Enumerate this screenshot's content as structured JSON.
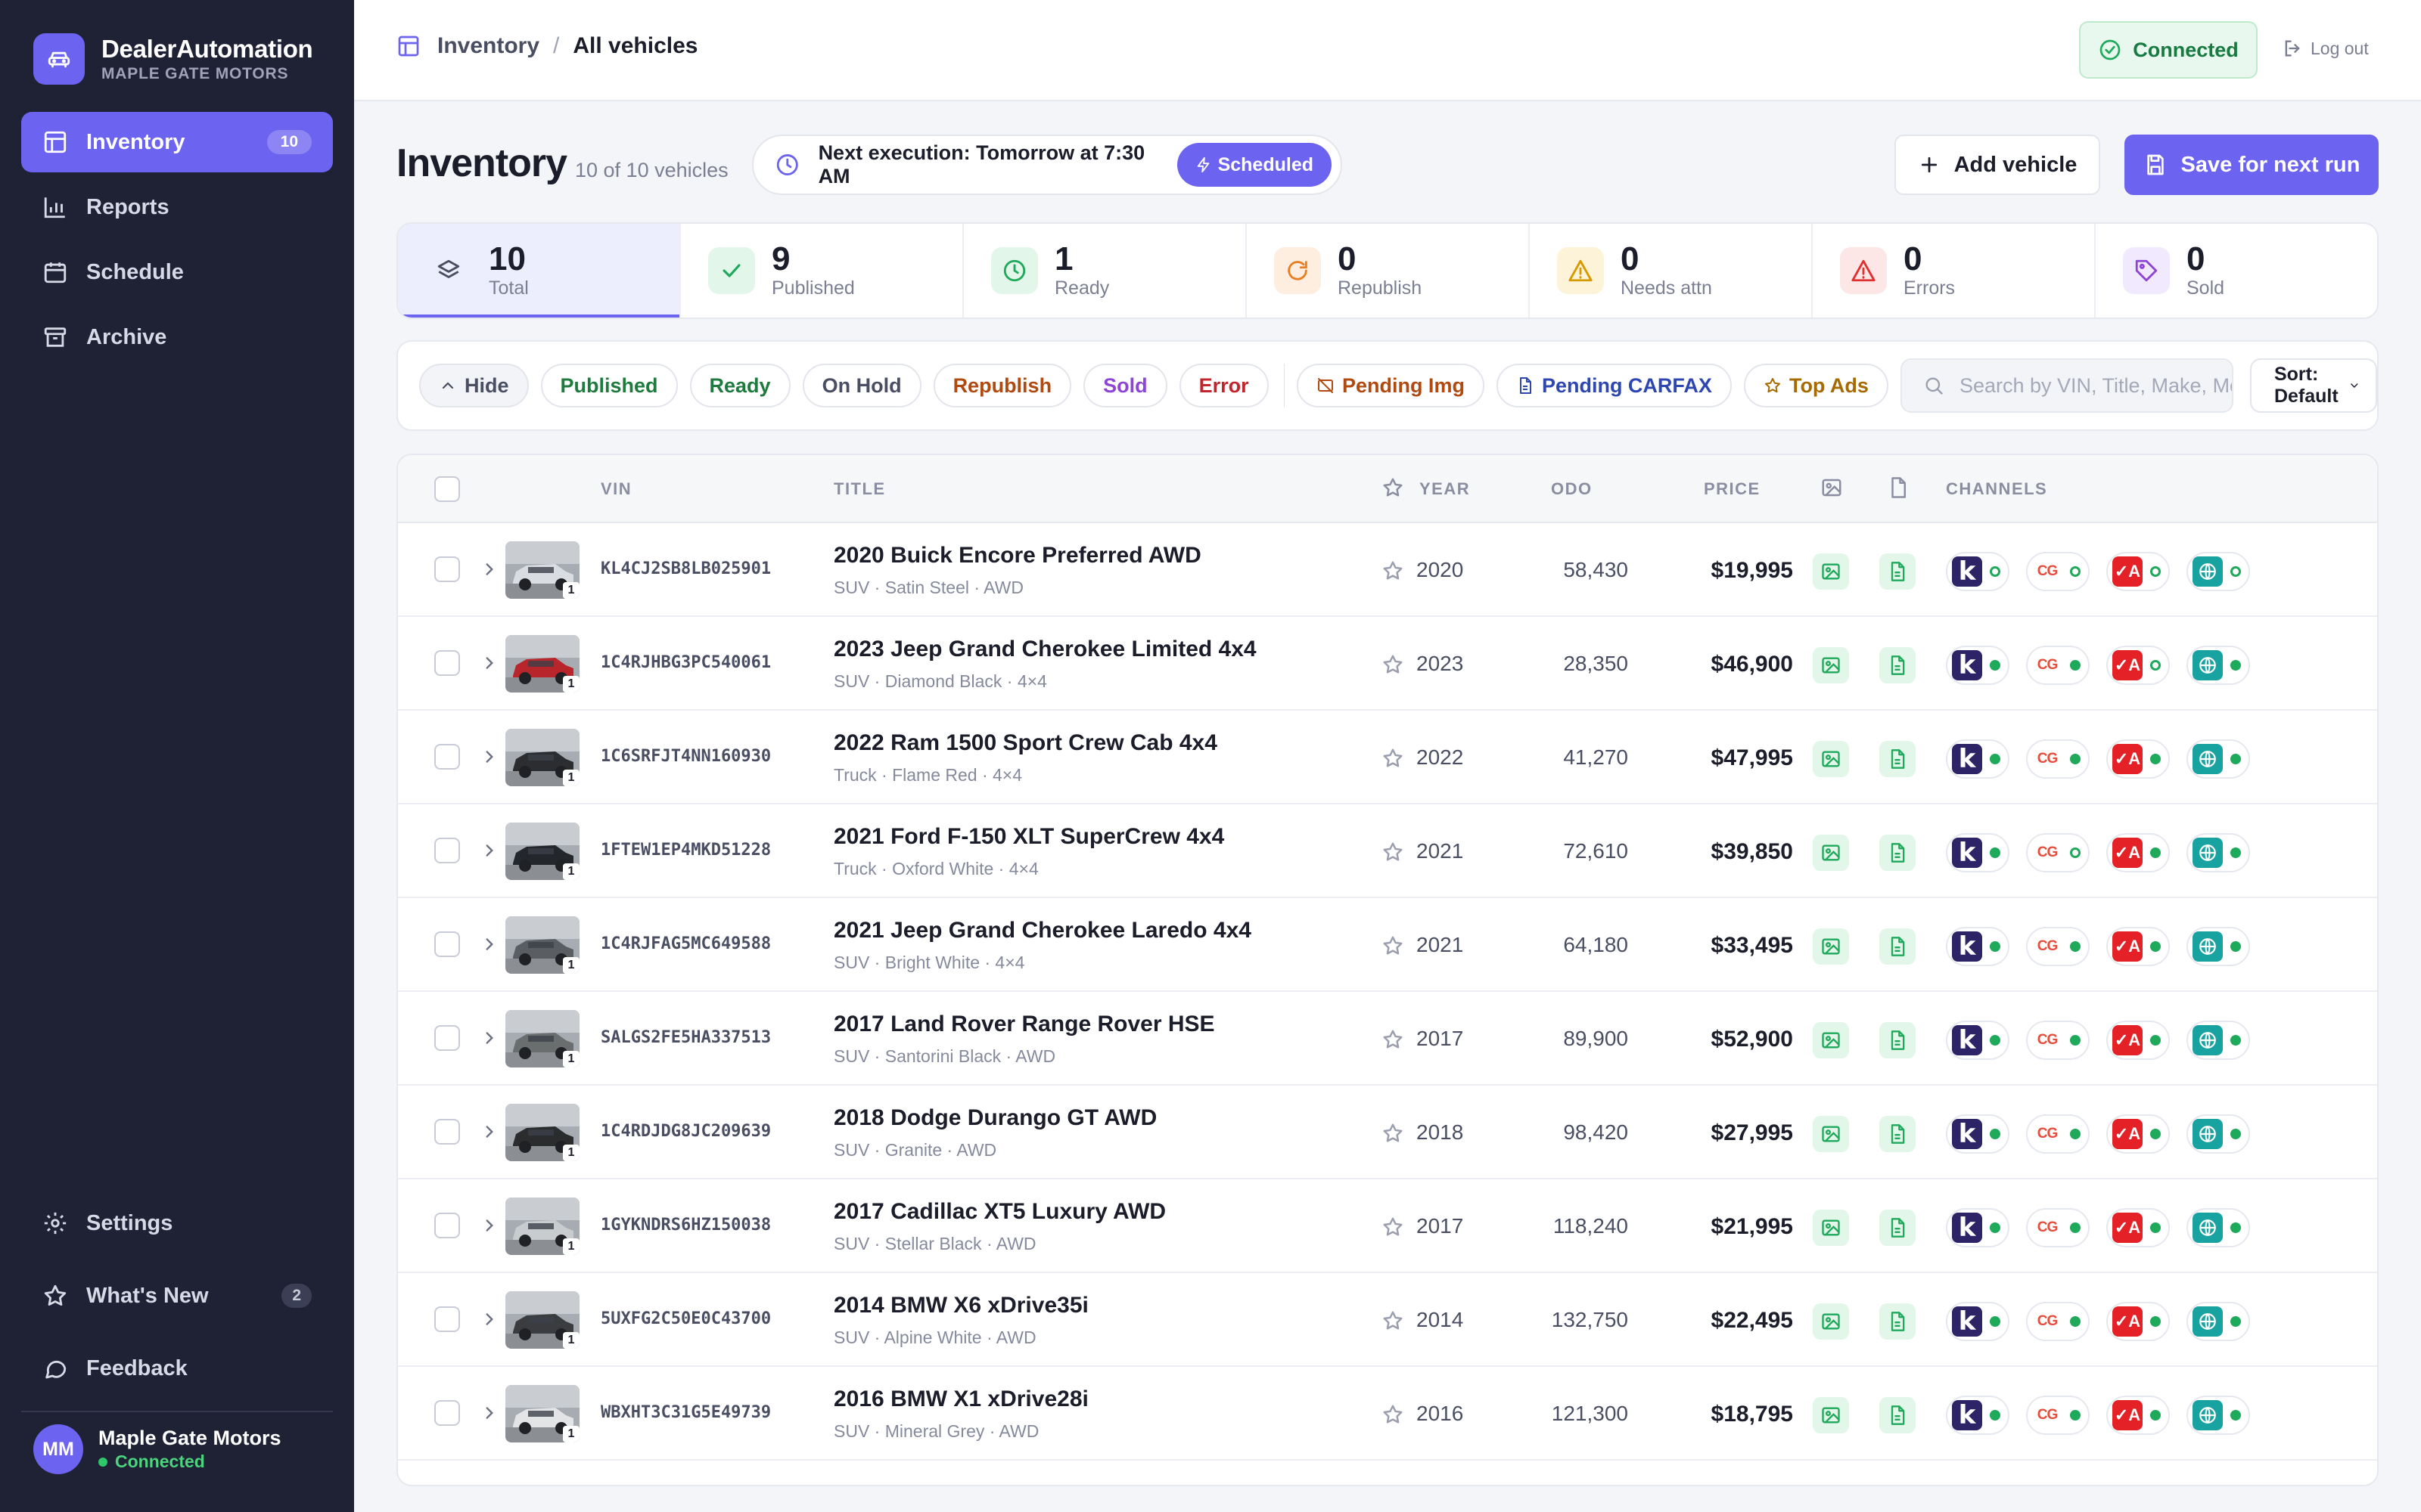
{
  "brand": {
    "name": "DealerAutomation",
    "subtitle": "MAPLE GATE MOTORS"
  },
  "nav": {
    "items": [
      {
        "label": "Inventory",
        "badge": "10"
      },
      {
        "label": "Reports"
      },
      {
        "label": "Schedule"
      },
      {
        "label": "Archive"
      }
    ],
    "bottom": [
      {
        "label": "Settings"
      },
      {
        "label": "What's New",
        "badge": "2"
      },
      {
        "label": "Feedback"
      }
    ]
  },
  "user": {
    "initials": "MM",
    "name": "Maple Gate Motors",
    "status": "Connected"
  },
  "header": {
    "breadcrumb": [
      "Inventory",
      "All vehicles"
    ],
    "breadcrumb_sep": "/",
    "connected": "Connected",
    "logout": "Log out"
  },
  "page": {
    "title": "Inventory",
    "subtitle": "10 of 10 vehicles",
    "next_execution": "Next execution: Tomorrow at 7:30 AM",
    "scheduled": "Scheduled",
    "add_vehicle": "Add vehicle",
    "save": "Save for next run"
  },
  "stats": [
    {
      "value": "10",
      "label": "Total"
    },
    {
      "value": "9",
      "label": "Published"
    },
    {
      "value": "1",
      "label": "Ready"
    },
    {
      "value": "0",
      "label": "Republish"
    },
    {
      "value": "0",
      "label": "Needs attn"
    },
    {
      "value": "0",
      "label": "Errors"
    },
    {
      "value": "0",
      "label": "Sold"
    }
  ],
  "filters": {
    "hide": "Hide",
    "status": [
      "Published",
      "Ready",
      "On Hold",
      "Republish",
      "Sold",
      "Error"
    ],
    "flags": [
      "Pending Img",
      "Pending CARFAX",
      "Top Ads"
    ],
    "search_placeholder": "Search by VIN, Title, Make, Mo",
    "sort": "Sort: Default"
  },
  "table": {
    "columns": {
      "vin": "VIN",
      "title": "TITLE",
      "year": "YEAR",
      "odo": "ODO",
      "price": "PRICE",
      "channels": "CHANNELS"
    },
    "channel_labels": {
      "k": "k",
      "cg": "CG",
      "a": "A"
    },
    "rows": [
      {
        "vin": "KL4CJ2SB8LB025901",
        "title": "2020 Buick Encore Preferred AWD",
        "sub": "SUV · Satin Steel · AWD",
        "year": "2020",
        "odo": "58,430",
        "price": "$19,995",
        "photos": "1",
        "color": "#d9dde2",
        "ch": [
          "off",
          "off",
          "off",
          "off"
        ]
      },
      {
        "vin": "1C4RJHBG3PC540061",
        "title": "2023 Jeep Grand Cherokee Limited 4x4",
        "sub": "SUV · Diamond Black · 4×4",
        "year": "2023",
        "odo": "28,350",
        "price": "$46,900",
        "photos": "1",
        "color": "#b8262c",
        "ch": [
          "on",
          "on",
          "off",
          "on"
        ]
      },
      {
        "vin": "1C6SRFJT4NN160930",
        "title": "2022 Ram 1500 Sport Crew Cab 4x4",
        "sub": "Truck · Flame Red · 4×4",
        "year": "2022",
        "odo": "41,270",
        "price": "$47,995",
        "photos": "1",
        "color": "#2b2d31",
        "ch": [
          "on",
          "on",
          "on",
          "on"
        ]
      },
      {
        "vin": "1FTEW1EP4MKD51228",
        "title": "2021 Ford F-150 XLT SuperCrew 4x4",
        "sub": "Truck · Oxford White · 4×4",
        "year": "2021",
        "odo": "72,610",
        "price": "$39,850",
        "photos": "1",
        "color": "#23272c",
        "ch": [
          "on",
          "off",
          "on",
          "on"
        ]
      },
      {
        "vin": "1C4RJFAG5MC649588",
        "title": "2021 Jeep Grand Cherokee Laredo 4x4",
        "sub": "SUV · Bright White · 4×4",
        "year": "2021",
        "odo": "64,180",
        "price": "$33,495",
        "photos": "1",
        "color": "#5a5e62",
        "ch": [
          "on",
          "on",
          "on",
          "on"
        ]
      },
      {
        "vin": "SALGS2FE5HA337513",
        "title": "2017 Land Rover Range Rover HSE",
        "sub": "SUV · Santorini Black · AWD",
        "year": "2017",
        "odo": "89,900",
        "price": "$52,900",
        "photos": "1",
        "color": "#6b6e6f",
        "ch": [
          "on",
          "on",
          "on",
          "on"
        ]
      },
      {
        "vin": "1C4RDJDG8JC209639",
        "title": "2018 Dodge Durango GT AWD",
        "sub": "SUV · Granite · AWD",
        "year": "2018",
        "odo": "98,420",
        "price": "$27,995",
        "photos": "1",
        "color": "#2a2c2e",
        "ch": [
          "on",
          "on",
          "on",
          "on"
        ]
      },
      {
        "vin": "1GYKNDRS6HZ150038",
        "title": "2017 Cadillac XT5 Luxury AWD",
        "sub": "SUV · Stellar Black · AWD",
        "year": "2017",
        "odo": "118,240",
        "price": "$21,995",
        "photos": "1",
        "color": "#c9cccf",
        "ch": [
          "on",
          "on",
          "on",
          "on"
        ]
      },
      {
        "vin": "5UXFG2C50E0C43700",
        "title": "2014 BMW X6 xDrive35i",
        "sub": "SUV · Alpine White · AWD",
        "year": "2014",
        "odo": "132,750",
        "price": "$22,495",
        "photos": "1",
        "color": "#3a3c40",
        "ch": [
          "on",
          "on",
          "on",
          "on"
        ]
      },
      {
        "vin": "WBXHT3C31G5E49739",
        "title": "2016 BMW X1 xDrive28i",
        "sub": "SUV · Mineral Grey · AWD",
        "year": "2016",
        "odo": "121,300",
        "price": "$18,795",
        "photos": "1",
        "color": "#e2e4e6",
        "ch": [
          "on",
          "on",
          "on",
          "on"
        ]
      }
    ]
  }
}
